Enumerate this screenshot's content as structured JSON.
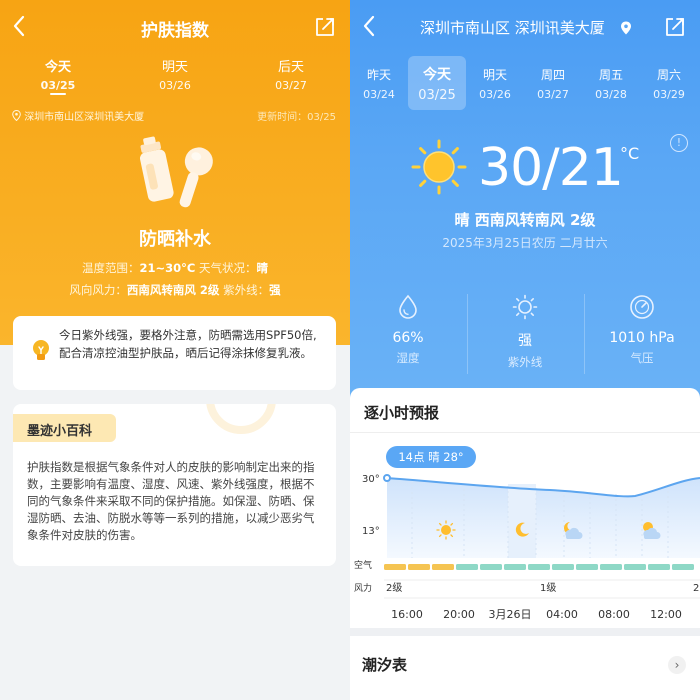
{
  "left": {
    "nav": {
      "title": "护肤指数"
    },
    "days": [
      {
        "name": "今天",
        "date": "03/25"
      },
      {
        "name": "明天",
        "date": "03/26"
      },
      {
        "name": "后天",
        "date": "03/27"
      }
    ],
    "location": "深圳市南山区深圳讯美大厦",
    "update_time": "更新时间：03/25",
    "headline": "防晒补水",
    "temp_range_label": "温度范围：",
    "temp_range_value": "21~30°C",
    "weather_label": " 天气状况：",
    "weather_value": "晴",
    "wind_label": "风向风力：",
    "wind_value": "西南风转南风 2级",
    "uv_label": " 紫外线：",
    "uv_value": "强",
    "tip": "今日紫外线强，要格外注意，防晒需选用SPF50倍,配合清凉控油型护肤品，晒后记得涂抹修复乳液。",
    "wiki_tag": "墨迹小百科",
    "wiki_text": "护肤指数是根据气象条件对人的皮肤的影响制定出来的指数，主要影响有温度、湿度、风速、紫外线强度，根据不同的气象条件来采取不同的保护措施。如保湿、防晒、保湿防晒、去油、防脱水等等一系列的措施，以减少恶劣气象条件对皮肤的伤害。"
  },
  "right": {
    "nav": {
      "title": "深圳市南山区 深圳讯美大厦"
    },
    "days": [
      {
        "name": "昨天",
        "date": "03/24"
      },
      {
        "name": "今天",
        "date": "03/25"
      },
      {
        "name": "明天",
        "date": "03/26"
      },
      {
        "name": "周四",
        "date": "03/27"
      },
      {
        "name": "周五",
        "date": "03/28"
      },
      {
        "name": "周六",
        "date": "03/29"
      }
    ],
    "temp": "30/21",
    "temp_unit": "°C",
    "info": "!",
    "condition": "晴  西南风转南风 2级",
    "date_line": "2025年3月25日农历 二月廿六",
    "stats": [
      {
        "value": "66%",
        "label": "湿度",
        "icon": "humidity-drop-icon"
      },
      {
        "value": "强",
        "label": "紫外线",
        "icon": "sun-uv-icon"
      },
      {
        "value": "1010 hPa",
        "label": "气压",
        "icon": "pressure-gauge-icon"
      }
    ],
    "hourly": {
      "title": "逐小时预报",
      "tooltip": "14点 晴 28°",
      "y_labels": [
        "30°",
        "13°"
      ],
      "air_label": "空气",
      "wind_label": "风力",
      "wind_levels": [
        "2级",
        "1级",
        "2"
      ],
      "time_labels": [
        "16:00",
        "20:00",
        "3月26日",
        "04:00",
        "08:00",
        "12:00"
      ]
    },
    "tide_title": "潮汐表",
    "tide_arrow": "›"
  },
  "colors": {
    "orange": "#f7a413",
    "blue": "#4a9cf3",
    "air_good": "#8ed8c6",
    "air_moderate": "#f5c452"
  }
}
